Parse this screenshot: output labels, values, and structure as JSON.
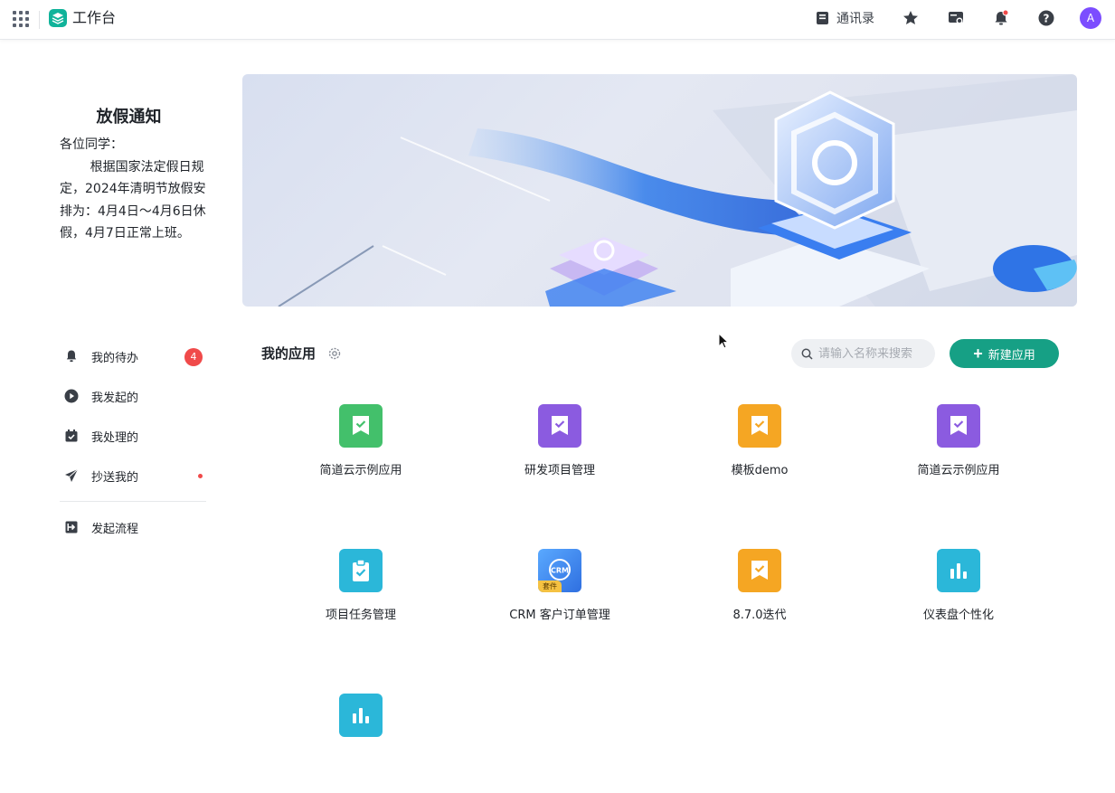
{
  "topbar": {
    "title": "工作台",
    "contacts_label": "通讯录",
    "avatar_letter": "A",
    "icons": [
      "grid-icon",
      "star-icon",
      "screen-settings-icon",
      "bell-icon",
      "help-icon"
    ],
    "brand_color": "#10b39a"
  },
  "notice": {
    "title": "放假通知",
    "greeting": "各位同学：",
    "body": "根据国家法定假日规定，2024年清明节放假安排为：4月4日～4月6日休假，4月7日正常上班。"
  },
  "sidebar": {
    "items": [
      {
        "label": "我的待办",
        "icon": "bell-icon",
        "badge": "4"
      },
      {
        "label": "我发起的",
        "icon": "play-circle-icon"
      },
      {
        "label": "我处理的",
        "icon": "check-box-icon"
      },
      {
        "label": "抄送我的",
        "icon": "send-icon",
        "dot": true
      }
    ],
    "start_flow": {
      "label": "发起流程",
      "icon": "start-flow-icon"
    }
  },
  "apps": {
    "title": "我的应用",
    "search_placeholder": "请输入名称来搜索",
    "new_button": "新建应用",
    "accent": "#16a085",
    "items": [
      {
        "name": "简道云示例应用",
        "color": "#43c06b",
        "icon": "bookmark-check-icon"
      },
      {
        "name": "研发项目管理",
        "color": "#8b5be0",
        "icon": "bookmark-check-icon"
      },
      {
        "name": "模板demo",
        "color": "#f5a623",
        "icon": "bookmark-check-icon"
      },
      {
        "name": "简道云示例应用",
        "color": "#8b5be0",
        "icon": "bookmark-check-icon"
      },
      {
        "name": "项目任务管理",
        "color": "#2bb7d9",
        "icon": "clipboard-check-icon"
      },
      {
        "name": "CRM 客户订单管理",
        "color": "#3a8bf0",
        "icon": "crm-icon",
        "icon_text": "CRM",
        "tag": "套件"
      },
      {
        "name": "8.7.0迭代",
        "color": "#f5a623",
        "icon": "bookmark-check-icon"
      },
      {
        "name": "仪表盘个性化",
        "color": "#2bb7d9",
        "icon": "bar-chart-icon"
      },
      {
        "name": "",
        "color": "#2bb7d9",
        "icon": "bar-chart-icon"
      }
    ]
  }
}
